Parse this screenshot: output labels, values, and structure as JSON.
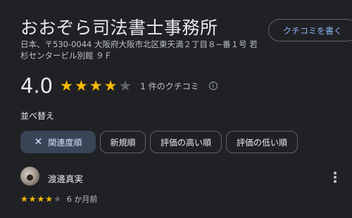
{
  "place": {
    "title": "おおぞら司法書士事務所",
    "address": "日本、〒530-0044 大阪府大阪市北区東天満２丁目８−番１号 若杉センタービル別館 ９Ｆ"
  },
  "write_review_label": "クチコミを書く",
  "rating": {
    "value": "4.0",
    "stars": 4,
    "max_stars": 5,
    "review_count_text": "1 件のクチコミ"
  },
  "sort": {
    "label": "並べ替え",
    "chips": [
      {
        "label": "関連度順",
        "selected": true
      },
      {
        "label": "新規順",
        "selected": false
      },
      {
        "label": "評価の高い順",
        "selected": false
      },
      {
        "label": "評価の低い順",
        "selected": false
      }
    ]
  },
  "review": {
    "author": "渡邊真実",
    "stars": 4,
    "max_stars": 5,
    "time": "6 か月前"
  },
  "colors": {
    "background": "#202124",
    "star_filled": "#fbbc04",
    "star_empty": "#5f6368",
    "link_blue": "#8ab4f8",
    "chip_selected_bg": "#394457"
  },
  "icons": {
    "star": "star-icon",
    "info": "info-icon",
    "close": "close-icon",
    "more": "more-vert-icon"
  }
}
